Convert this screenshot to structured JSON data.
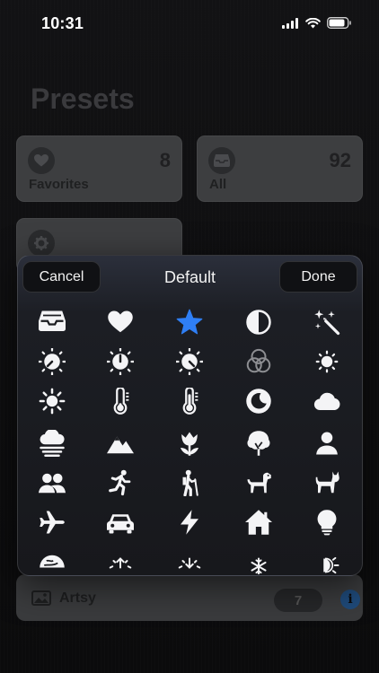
{
  "status_bar": {
    "time": "10:31"
  },
  "page": {
    "title": "Presets"
  },
  "cards": [
    {
      "label": "Favorites",
      "count": "8",
      "icon": "heart-icon"
    },
    {
      "label": "All",
      "count": "92",
      "icon": "tray-icon"
    },
    {
      "label": "",
      "count": "",
      "icon": "gear-icon"
    }
  ],
  "bottom_row": {
    "label": "Artsy",
    "badge": "7",
    "info": "i",
    "icon": "photo-icon"
  },
  "picker": {
    "cancel_label": "Cancel",
    "title": "Default",
    "done_label": "Done",
    "accent_color": "#2f7ff5",
    "icons": [
      [
        "tray-icon",
        "heart-icon",
        "star-icon",
        "half-circle-icon",
        "magic-wand-icon"
      ],
      [
        "dial-low-icon",
        "dial-mid-icon",
        "dial-high-icon",
        "rings-icon",
        "sun-small-icon"
      ],
      [
        "sun-icon",
        "thermometer-low-icon",
        "thermometer-high-icon",
        "moon-icon",
        "cloud-icon"
      ],
      [
        "fog-icon",
        "mountains-icon",
        "tulip-icon",
        "tree-icon",
        "person-icon"
      ],
      [
        "people-icon",
        "runner-icon",
        "hiker-icon",
        "dog-icon",
        "cat-icon"
      ],
      [
        "airplane-icon",
        "car-icon",
        "bolt-icon",
        "house-icon",
        "lightbulb-icon"
      ],
      [
        "globe-icon",
        "sunrise-icon",
        "sunset-icon",
        "snowflake-icon",
        "lamp-icon"
      ]
    ],
    "selected_icon": "star-icon"
  }
}
